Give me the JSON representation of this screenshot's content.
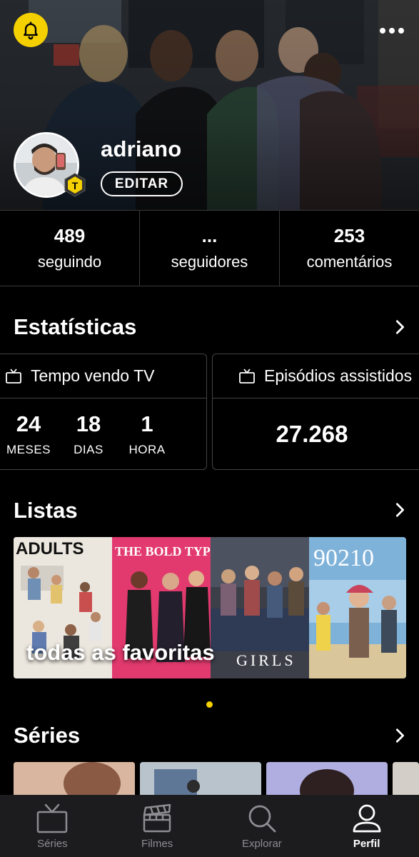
{
  "header": {
    "background_image": "group of friends sitting on a subway train",
    "notifications_icon": "bell-icon",
    "more_icon": "more-horizontal-icon",
    "avatar_image": "profile photo of user taking a mirror selfie",
    "tier_badge": "T"
  },
  "profile": {
    "username": "adriano",
    "edit_label": "EDITAR"
  },
  "counters": [
    {
      "value": "489",
      "label": "seguindo"
    },
    {
      "value": "...",
      "label": "seguidores"
    },
    {
      "value": "253",
      "label": "comentários"
    }
  ],
  "stats": {
    "title": "Estatísticas",
    "tv_time": {
      "title": "Tempo vendo TV",
      "icon": "tv-icon",
      "items": [
        {
          "value": "24",
          "unit": "MESES"
        },
        {
          "value": "18",
          "unit": "DIAS"
        },
        {
          "value": "1",
          "unit": "HORA"
        }
      ]
    },
    "episodes": {
      "title": "Episódios assistidos",
      "icon": "tv-icon",
      "value": "27.268"
    }
  },
  "lists": {
    "title": "Listas",
    "items": [
      {
        "name": "todas as favoritas",
        "posters": [
          {
            "title": "ADULTS",
            "color": "#e9e4dc"
          },
          {
            "title": "THE BOLD TYPE",
            "color": "#e23a6e"
          },
          {
            "title": "GIRLS",
            "color": "#3c3f48"
          },
          {
            "title": "90210",
            "color": "#7fb2d9"
          }
        ]
      }
    ],
    "active_page": 1
  },
  "series": {
    "title": "Séries"
  },
  "nav": {
    "items": [
      {
        "label": "Séries",
        "icon": "tv-icon",
        "active": false
      },
      {
        "label": "Filmes",
        "icon": "clapperboard-icon",
        "active": false
      },
      {
        "label": "Explorar",
        "icon": "search-icon",
        "active": false
      },
      {
        "label": "Perfil",
        "icon": "user-icon",
        "active": true
      }
    ]
  },
  "colors": {
    "accent": "#f5d000",
    "background": "#000000",
    "nav_background": "#1c1c1e",
    "inactive_nav": "#8d8d92"
  }
}
